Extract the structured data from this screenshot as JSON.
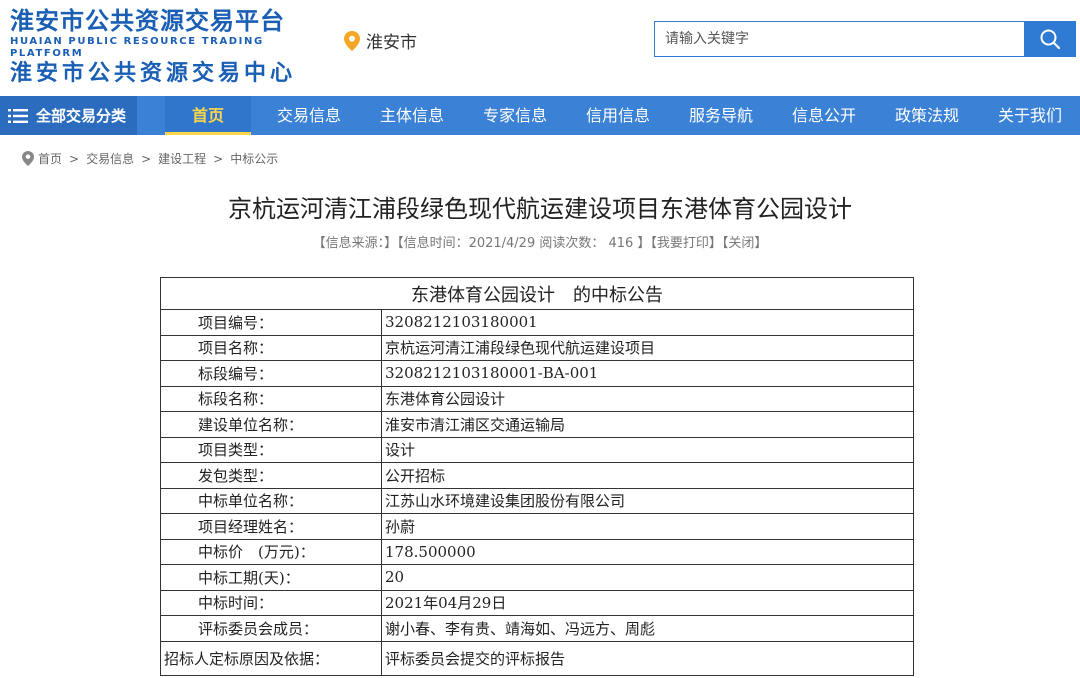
{
  "header": {
    "logo_line1": "淮安市公共资源交易平台",
    "logo_en": "HUAIAN PUBLIC RESOURCE TRADING PLATFORM",
    "logo_line2": "淮安市公共资源交易中心",
    "city": "淮安市",
    "search_placeholder": "请输入关键字"
  },
  "nav": {
    "all_label": "全部交易分类",
    "items": [
      "首页",
      "交易信息",
      "主体信息",
      "专家信息",
      "信用信息",
      "服务导航",
      "信息公开",
      "政策法规",
      "关于我们"
    ],
    "active_index": 0
  },
  "breadcrumb": [
    "首页",
    "交易信息",
    "建设工程",
    "中标公示"
  ],
  "article": {
    "title": "京杭运河清江浦段绿色现代航运建设项目东港体育公园设计",
    "meta": "【信息来源：】【信息时间：2021/4/29 阅读次数： 416 】【我要打印】【关闭】"
  },
  "notice": {
    "caption": "东港体育公园设计　的中标公告",
    "rows": [
      {
        "label": "项目编号：",
        "value": "3208212103180001"
      },
      {
        "label": "项目名称：",
        "value": "京杭运河清江浦段绿色现代航运建设项目"
      },
      {
        "label": "标段编号：",
        "value": "3208212103180001-BA-001"
      },
      {
        "label": "标段名称：",
        "value": "东港体育公园设计"
      },
      {
        "label": "建设单位名称：",
        "value": "淮安市清江浦区交通运输局"
      },
      {
        "label": "项目类型：",
        "value": "设计"
      },
      {
        "label": "发包类型：",
        "value": "公开招标"
      },
      {
        "label": "中标单位名称：",
        "value": "江苏山水环境建设集团股份有限公司"
      },
      {
        "label": "项目经理姓名：",
        "value": "孙蔚"
      },
      {
        "label": "中标价　(万元)：",
        "value": "178.500000"
      },
      {
        "label": "中标工期(天)：",
        "value": "20"
      },
      {
        "label": "中标时间：",
        "value": "2021年04月29日"
      },
      {
        "label": "评标委员会成员：",
        "value": "谢小春、李有贵、靖海如、冯远方、周彪"
      },
      {
        "label": "招标人定标原因及依据：",
        "value": "评标委员会提交的评标报告"
      }
    ]
  },
  "colors": {
    "brand": "#1a5fb4",
    "nav_bg": "#3b82d6",
    "active": "#ffd54a"
  }
}
